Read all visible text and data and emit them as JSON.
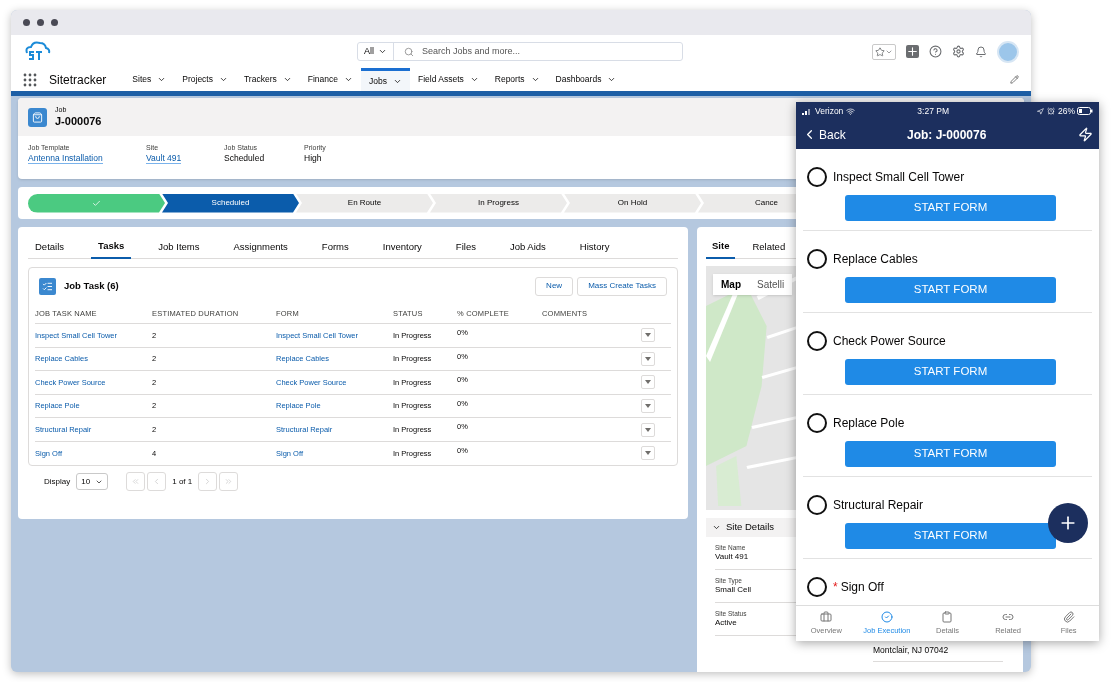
{
  "app": {
    "name": "Sitetracker"
  },
  "search": {
    "scope": "All",
    "placeholder": "Search Jobs and more..."
  },
  "nav": [
    {
      "label": "Sites",
      "selected": false
    },
    {
      "label": "Projects",
      "selected": false
    },
    {
      "label": "Trackers",
      "selected": false
    },
    {
      "label": "Finance",
      "selected": false
    },
    {
      "label": "Jobs",
      "selected": true
    },
    {
      "label": "Field Assets",
      "selected": false
    },
    {
      "label": "Reports",
      "selected": false
    },
    {
      "label": "Dashboards",
      "selected": false
    }
  ],
  "record": {
    "type": "Job",
    "name": "J-000076",
    "fields": [
      {
        "label": "Job Template",
        "value": "Antenna Installation",
        "kind": "link"
      },
      {
        "label": "Site",
        "value": "Vault 491",
        "kind": "link"
      },
      {
        "label": "Job Status",
        "value": "Scheduled",
        "kind": "text"
      },
      {
        "label": "Priority",
        "value": "High",
        "kind": "text"
      }
    ]
  },
  "path": [
    {
      "kind": "complete"
    },
    {
      "label": "Scheduled",
      "kind": "current"
    },
    {
      "label": "En Route",
      "kind": "pending"
    },
    {
      "label": "In Progress",
      "kind": "pending"
    },
    {
      "label": "On Hold",
      "kind": "pending"
    },
    {
      "label": "Cance",
      "kind": "pending"
    }
  ],
  "tabs": [
    {
      "label": "Details",
      "selected": false
    },
    {
      "label": "Tasks",
      "selected": true
    },
    {
      "label": "Job Items",
      "selected": false
    },
    {
      "label": "Assignments",
      "selected": false
    },
    {
      "label": "Forms",
      "selected": false
    },
    {
      "label": "Inventory",
      "selected": false
    },
    {
      "label": "Files",
      "selected": false
    },
    {
      "label": "Job Aids",
      "selected": false
    },
    {
      "label": "History",
      "selected": false
    }
  ],
  "task_card": {
    "title": "Job Task (6)",
    "buttons": [
      "New",
      "Mass Create Tasks"
    ],
    "columns": [
      "JOB TASK NAME",
      "ESTIMATED DURATION",
      "FORM",
      "STATUS",
      "% COMPLETE",
      "COMMENTS"
    ],
    "rows": [
      {
        "name": "Inspect Small Cell Tower",
        "duration": "2",
        "form": "Inspect Small Cell Tower",
        "status": "In Progress",
        "complete": "0%"
      },
      {
        "name": "Replace Cables",
        "duration": "2",
        "form": "Replace Cables",
        "status": "In Progress",
        "complete": "0%"
      },
      {
        "name": "Check Power Source",
        "duration": "2",
        "form": "Check Power Source",
        "status": "In Progress",
        "complete": "0%"
      },
      {
        "name": "Replace Pole",
        "duration": "2",
        "form": "Replace Pole",
        "status": "In Progress",
        "complete": "0%"
      },
      {
        "name": "Structural Repair",
        "duration": "2",
        "form": "Structural Repair",
        "status": "In Progress",
        "complete": "0%"
      },
      {
        "name": "Sign Off",
        "duration": "4",
        "form": "Sign Off",
        "status": "In Progress",
        "complete": "0%"
      }
    ],
    "display_label": "Display",
    "display_value": "10",
    "page": "1 of 1"
  },
  "side_panel": {
    "tabs": [
      {
        "label": "Site",
        "selected": true
      },
      {
        "label": "Related",
        "selected": false
      }
    ],
    "map_toggle": [
      {
        "label": "Map",
        "selected": true
      },
      {
        "label": "Satelli",
        "selected": false
      }
    ],
    "section": "Site Details",
    "fields": [
      {
        "label": "Site Name",
        "value": "Vault 491"
      },
      {
        "label": "Site Type",
        "value": "Small Cell"
      },
      {
        "label": "Site Status",
        "value": "Active"
      }
    ],
    "address": "Montclair, NJ 07042"
  },
  "phone": {
    "carrier": "Verizon",
    "time": "3:27 PM",
    "battery": "26%",
    "back": "Back",
    "title": "Job: J-000076",
    "tasks": [
      {
        "name": "Inspect Small Cell Tower",
        "checked": false,
        "button": "START FORM"
      },
      {
        "name": "Replace Cables",
        "checked": false,
        "button": "START FORM"
      },
      {
        "name": "Check Power Source",
        "checked": false,
        "button": "START FORM"
      },
      {
        "name": "Replace Pole",
        "checked": false,
        "button": "START FORM"
      },
      {
        "name": "Structural Repair",
        "checked": false,
        "button": "START FORM"
      },
      {
        "name": "Sign Off",
        "required_mark": "*",
        "checked": false
      }
    ],
    "tabbar": [
      {
        "label": "Overview",
        "kind": "briefcase",
        "selected": false
      },
      {
        "label": "Job Execution",
        "kind": "check",
        "selected": true
      },
      {
        "label": "Details",
        "kind": "clipboard",
        "selected": false
      },
      {
        "label": "Related",
        "kind": "link",
        "selected": false
      },
      {
        "label": "Files",
        "kind": "clip",
        "selected": false
      }
    ]
  }
}
